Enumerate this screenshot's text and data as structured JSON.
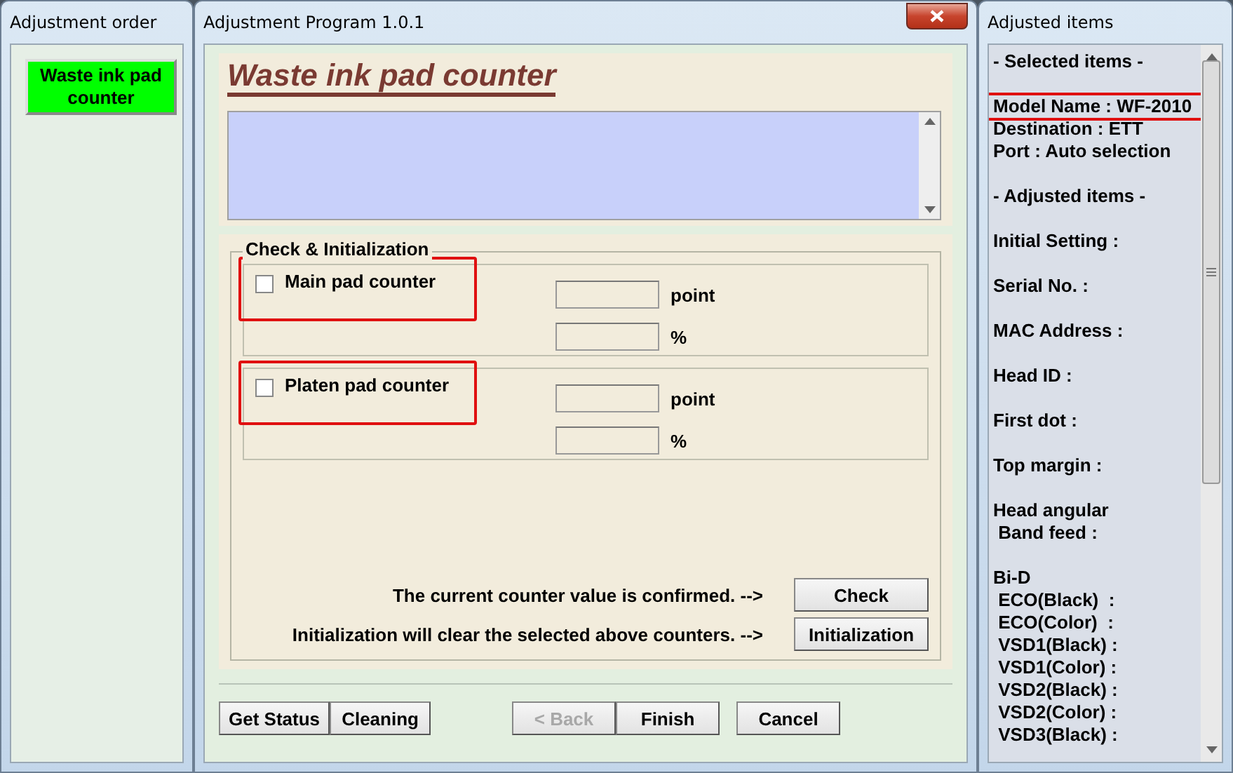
{
  "order_window": {
    "title": "Adjustment order",
    "items": [
      {
        "label": "Waste ink pad counter",
        "selected": true
      }
    ]
  },
  "program_window": {
    "title": "Adjustment Program 1.0.1",
    "heading": "Waste ink pad counter",
    "group": {
      "title": "Check & Initialization",
      "counters": [
        {
          "label": "Main pad counter",
          "checked": false,
          "highlighted": true,
          "point_unit": "point",
          "percent_unit": "%"
        },
        {
          "label": "Platen pad counter",
          "checked": false,
          "highlighted": true,
          "point_unit": "point",
          "percent_unit": "%"
        }
      ],
      "actions": [
        {
          "text": "The current counter value is confirmed. -->",
          "button": "Check"
        },
        {
          "text": "Initialization will clear the selected above counters. -->",
          "button": "Initialization"
        }
      ]
    },
    "left_buttons": [
      {
        "label": "Get Status",
        "disabled": false
      },
      {
        "label": "Cleaning",
        "disabled": false
      }
    ],
    "nav_buttons": [
      {
        "label": "< Back",
        "disabled": true
      },
      {
        "label": "Finish",
        "disabled": false
      },
      {
        "label": "Cancel",
        "disabled": false
      }
    ]
  },
  "items_window": {
    "title": "Adjusted items",
    "blocks": [
      [
        {
          "text": "- Selected items -",
          "highlighted": false
        }
      ],
      [
        {
          "text": "Model Name : WF-2010",
          "highlighted": true
        },
        {
          "text": "Destination : ETT",
          "highlighted": false
        },
        {
          "text": "Port : Auto selection",
          "highlighted": false
        }
      ],
      [
        {
          "text": "- Adjusted items -",
          "highlighted": false
        }
      ],
      [
        {
          "text": "Initial Setting :",
          "highlighted": false
        }
      ],
      [
        {
          "text": "Serial No. :",
          "highlighted": false
        }
      ],
      [
        {
          "text": "MAC Address :",
          "highlighted": false
        }
      ],
      [
        {
          "text": "Head ID :",
          "highlighted": false
        }
      ],
      [
        {
          "text": "First dot :",
          "highlighted": false
        }
      ],
      [
        {
          "text": "Top margin :",
          "highlighted": false
        }
      ],
      [
        {
          "text": "Head angular",
          "highlighted": false
        },
        {
          "text": " Band feed :",
          "highlighted": false
        }
      ],
      [
        {
          "text": "Bi-D",
          "highlighted": false
        },
        {
          "text": " ECO(Black)  :",
          "highlighted": false
        },
        {
          "text": " ECO(Color)  :",
          "highlighted": false
        },
        {
          "text": " VSD1(Black) :",
          "highlighted": false
        },
        {
          "text": " VSD1(Color) :",
          "highlighted": false
        },
        {
          "text": " VSD2(Black) :",
          "highlighted": false
        },
        {
          "text": " VSD2(Color) :",
          "highlighted": false
        },
        {
          "text": " VSD3(Black) :",
          "highlighted": false
        }
      ]
    ]
  }
}
